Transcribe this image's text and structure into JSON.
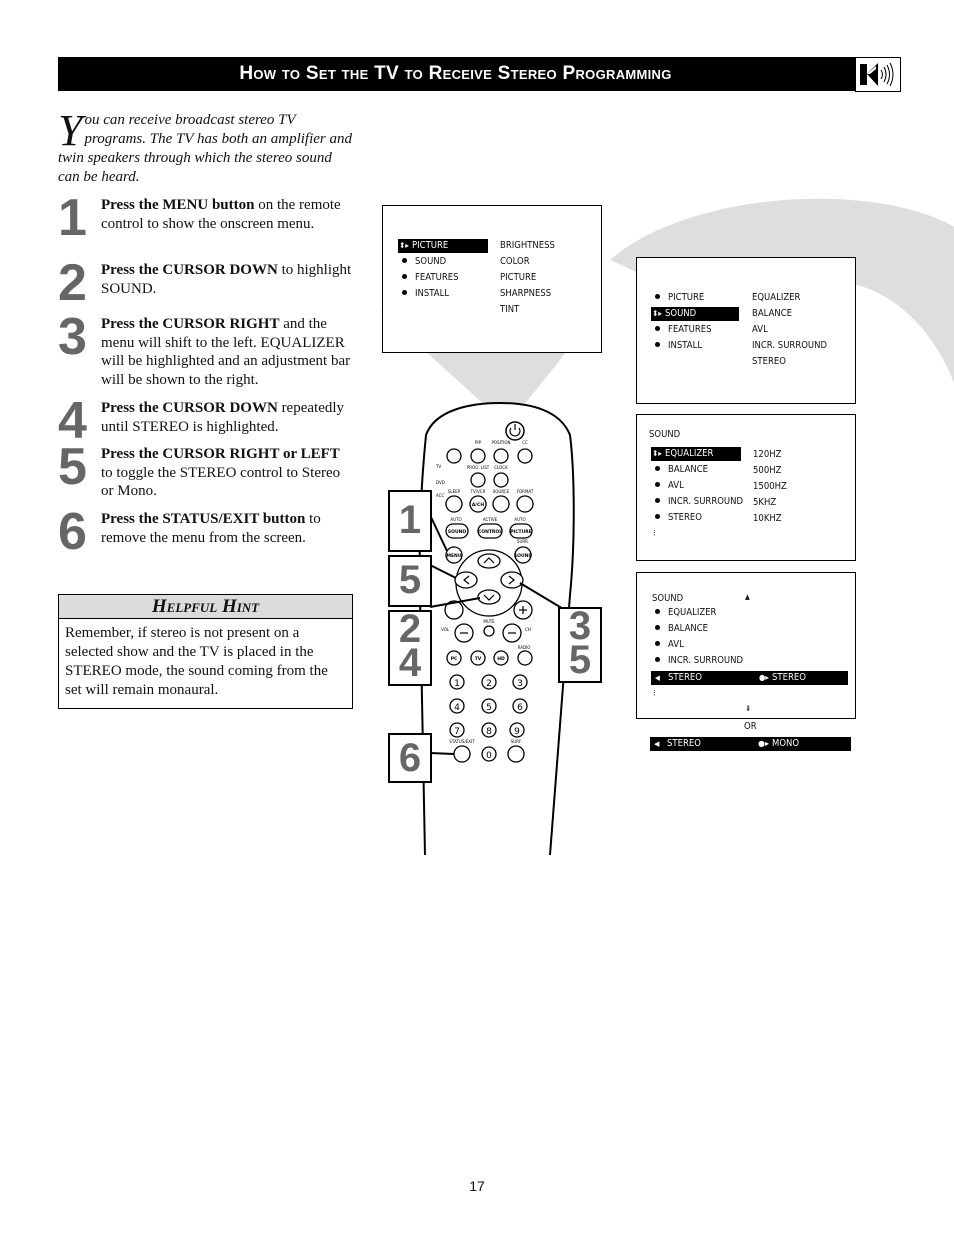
{
  "header": {
    "title": "How to Set the TV to Receive Stereo Programming",
    "icon": "speaker-icon"
  },
  "intro": {
    "dropcap": "Y",
    "text": "ou can receive broadcast stereo TV programs. The TV has both an amplifier and twin speakers through which the stereo sound can be heard."
  },
  "steps": [
    {
      "num": "1",
      "bold": "Press the MENU button",
      "text": " on the remote control to show the onscreen menu."
    },
    {
      "num": "2",
      "bold": "Press the CURSOR DOWN",
      "text": " to highlight SOUND."
    },
    {
      "num": "3",
      "bold": "Press the CURSOR RIGHT",
      "text": " and the menu will shift to the left. EQUALIZER will be highlighted and an adjustment bar will be shown to the right."
    },
    {
      "num": "4",
      "bold": "Press the CURSOR DOWN",
      "text": " repeatedly until STEREO is highlighted."
    },
    {
      "num": "5",
      "bold": "Press the CURSOR RIGHT or LEFT",
      "text": " to toggle  the STEREO control to Stereo or Mono."
    },
    {
      "num": "6",
      "bold": "Press the STATUS/EXIT button",
      "text": " to remove the menu from the screen."
    }
  ],
  "hint": {
    "title": "Helpful Hint",
    "body": "Remember, if stereo is not present on a selected show and the TV is placed in the STEREO mode, the sound coming from the set will remain monaural."
  },
  "osd1": {
    "menu": [
      "PICTURE",
      "SOUND",
      "FEATURES",
      "INSTALL"
    ],
    "selected": 0,
    "submenu": [
      "BRIGHTNESS",
      "COLOR",
      "PICTURE",
      "SHARPNESS",
      "TINT"
    ]
  },
  "osd2": {
    "menu": [
      "PICTURE",
      "SOUND",
      "FEATURES",
      "INSTALL"
    ],
    "selected": 1,
    "submenu": [
      "EQUALIZER",
      "BALANCE",
      "AVL",
      "INCR. SURROUND",
      "STEREO"
    ]
  },
  "osd3": {
    "heading": "SOUND",
    "menu": [
      "EQUALIZER",
      "BALANCE",
      "AVL",
      "INCR. SURROUND",
      "STEREO"
    ],
    "selected": 0,
    "values": [
      "120HZ",
      "500HZ",
      "1500HZ",
      "5KHZ",
      "10KHZ"
    ]
  },
  "osd4": {
    "heading": "SOUND",
    "menu": [
      "EQUALIZER",
      "BALANCE",
      "AVL",
      "INCR. SURROUND"
    ],
    "stereo_label": "STEREO",
    "stereo_value": "STEREO",
    "or_label": "OR",
    "alt_label": "STEREO",
    "alt_value": "MONO"
  },
  "remote": {
    "side_labels": [
      "TV",
      "DVD",
      "ACC"
    ],
    "top_labels": [
      "PIP",
      "POSITION",
      "CC",
      "PROG. LIST",
      "CLOCK",
      "SLEEP",
      "TV/VCR",
      "SOURCE",
      "FORMAT",
      "A/CH"
    ],
    "row_labels": [
      "AUTO",
      "ACTIVE",
      "AUTO",
      "SURR."
    ],
    "pill_buttons": [
      "SOUND",
      "CONTROL",
      "PICTURE"
    ],
    "menu_button": "MENU",
    "sound_button": "SOUND",
    "vol_label": "VOL",
    "ch_label": "CH",
    "mute_label": "MUTE",
    "radio_label": "RADIO",
    "source_buttons": [
      "PC",
      "TV",
      "HD"
    ],
    "digits": [
      "1",
      "2",
      "3",
      "4",
      "5",
      "6",
      "7",
      "8",
      "9",
      "0"
    ],
    "status_label": "STATUS/EXIT",
    "surf_label": "SURF"
  },
  "callouts": [
    "1",
    "5",
    "2\n4",
    "3\n5",
    "6"
  ],
  "page_number": "17"
}
